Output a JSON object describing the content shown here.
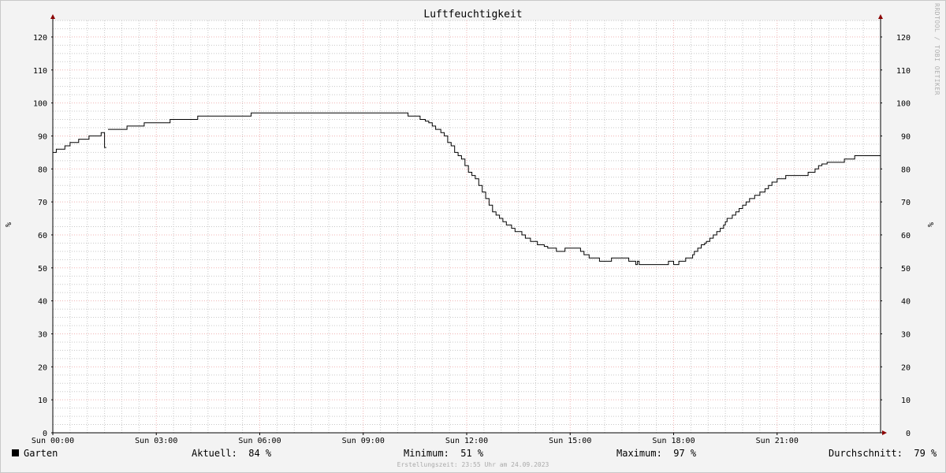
{
  "chart_data": {
    "type": "line",
    "title": "Luftfeuchtigkeit",
    "ylabel_left": "%",
    "ylabel_right": "%",
    "ylim": [
      0,
      125
    ],
    "xlim": [
      0,
      24
    ],
    "yticks": [
      0,
      10,
      20,
      30,
      40,
      50,
      60,
      70,
      80,
      90,
      100,
      110,
      120
    ],
    "xticks": [
      {
        "value": 0,
        "label": "Sun 00:00"
      },
      {
        "value": 3,
        "label": "Sun 03:00"
      },
      {
        "value": 6,
        "label": "Sun 06:00"
      },
      {
        "value": 9,
        "label": "Sun 09:00"
      },
      {
        "value": 12,
        "label": "Sun 12:00"
      },
      {
        "value": 15,
        "label": "Sun 15:00"
      },
      {
        "value": 18,
        "label": "Sun 18:00"
      },
      {
        "value": 21,
        "label": "Sun 21:00"
      }
    ],
    "grid": true,
    "series": [
      {
        "name": "Garten",
        "color": "#000000",
        "segments": [
          [
            [
              0,
              85
            ],
            [
              0.1,
              86
            ],
            [
              0.35,
              87
            ],
            [
              0.5,
              88
            ],
            [
              0.7,
              88
            ],
            [
              0.75,
              89
            ],
            [
              1.0,
              89
            ],
            [
              1.05,
              90
            ],
            [
              1.3,
              90
            ],
            [
              1.4,
              91
            ],
            [
              1.48,
              91
            ],
            [
              1.5,
              86.5
            ],
            [
              1.55,
              86.5
            ]
          ],
          [
            [
              1.6,
              92
            ],
            [
              2.05,
              92
            ],
            [
              2.15,
              93
            ],
            [
              2.6,
              93
            ],
            [
              2.65,
              94
            ],
            [
              3.35,
              94
            ],
            [
              3.4,
              95
            ],
            [
              4.15,
              95
            ],
            [
              4.2,
              96
            ],
            [
              5.7,
              96
            ],
            [
              5.75,
              97
            ],
            [
              10.2,
              97
            ],
            [
              10.3,
              96
            ],
            [
              10.6,
              96
            ],
            [
              10.65,
              95
            ],
            [
              10.8,
              94.5
            ],
            [
              10.9,
              94
            ],
            [
              11.0,
              93
            ],
            [
              11.1,
              92
            ],
            [
              11.25,
              91
            ],
            [
              11.35,
              90
            ],
            [
              11.45,
              88
            ],
            [
              11.55,
              87
            ],
            [
              11.65,
              85
            ],
            [
              11.75,
              84
            ],
            [
              11.85,
              83
            ],
            [
              11.95,
              81
            ],
            [
              12.05,
              79
            ],
            [
              12.15,
              78
            ],
            [
              12.25,
              77
            ],
            [
              12.35,
              75
            ],
            [
              12.45,
              73
            ],
            [
              12.55,
              71
            ],
            [
              12.65,
              69
            ],
            [
              12.75,
              67
            ],
            [
              12.85,
              66
            ],
            [
              12.95,
              65
            ],
            [
              13.05,
              64
            ],
            [
              13.15,
              63
            ],
            [
              13.3,
              62
            ],
            [
              13.4,
              61
            ],
            [
              13.6,
              60
            ],
            [
              13.7,
              59
            ],
            [
              13.85,
              58
            ],
            [
              14.05,
              57
            ],
            [
              14.25,
              56.5
            ],
            [
              14.35,
              56
            ],
            [
              14.6,
              55
            ],
            [
              14.8,
              55
            ],
            [
              14.85,
              56
            ],
            [
              15.2,
              56
            ],
            [
              15.3,
              55
            ],
            [
              15.4,
              54
            ],
            [
              15.55,
              53
            ],
            [
              15.8,
              53
            ],
            [
              15.85,
              52
            ],
            [
              16.1,
              52
            ],
            [
              16.2,
              53
            ],
            [
              16.65,
              53
            ],
            [
              16.7,
              52
            ],
            [
              16.85,
              52
            ],
            [
              16.9,
              51
            ],
            [
              16.95,
              52
            ],
            [
              17.0,
              51
            ],
            [
              17.8,
              51
            ],
            [
              17.85,
              52
            ],
            [
              17.95,
              52
            ],
            [
              18.0,
              51
            ],
            [
              18.1,
              51
            ],
            [
              18.15,
              52
            ],
            [
              18.3,
              52
            ],
            [
              18.35,
              53
            ],
            [
              18.45,
              53
            ],
            [
              18.55,
              54
            ],
            [
              18.6,
              55
            ],
            [
              18.7,
              56
            ],
            [
              18.8,
              57
            ],
            [
              18.9,
              57.5
            ],
            [
              18.95,
              58
            ],
            [
              19.05,
              59
            ],
            [
              19.15,
              60
            ],
            [
              19.25,
              61
            ],
            [
              19.35,
              62
            ],
            [
              19.45,
              63
            ],
            [
              19.5,
              64
            ],
            [
              19.55,
              65
            ],
            [
              19.7,
              66
            ],
            [
              19.8,
              67
            ],
            [
              19.9,
              68
            ],
            [
              20.0,
              69
            ],
            [
              20.1,
              70
            ],
            [
              20.2,
              71
            ],
            [
              20.35,
              72
            ],
            [
              20.5,
              73
            ],
            [
              20.65,
              74
            ],
            [
              20.75,
              75
            ],
            [
              20.85,
              76
            ],
            [
              21.0,
              77
            ],
            [
              21.2,
              77
            ],
            [
              21.25,
              78
            ],
            [
              21.85,
              78
            ],
            [
              21.9,
              79
            ],
            [
              22.0,
              79
            ],
            [
              22.1,
              80
            ],
            [
              22.2,
              81
            ],
            [
              22.3,
              81.5
            ],
            [
              22.45,
              82
            ],
            [
              22.9,
              82
            ],
            [
              22.95,
              83
            ],
            [
              23.2,
              83
            ],
            [
              23.25,
              84
            ],
            [
              24.0,
              84
            ]
          ]
        ]
      }
    ],
    "legend": [
      {
        "label": "Garten"
      },
      {
        "label": "Aktuell:",
        "value": "84 %"
      },
      {
        "label": "Minimum:",
        "value": "51 %"
      },
      {
        "label": "Maximum:",
        "value": "97 %"
      },
      {
        "label": "Durchschnitt:",
        "value": "79 %"
      }
    ],
    "watermark": "RRDTOOL / TOBI OETIKER",
    "footer": "Erstellungszeit: 23:55 Uhr am 24.09.2023",
    "colors": {
      "background": "#f3f3f3",
      "plot": "#ffffff",
      "major_grid": "#f0b4b4",
      "minor_grid": "#c8c8c8",
      "axis": "#000000",
      "arrow": "#8b0000"
    }
  }
}
